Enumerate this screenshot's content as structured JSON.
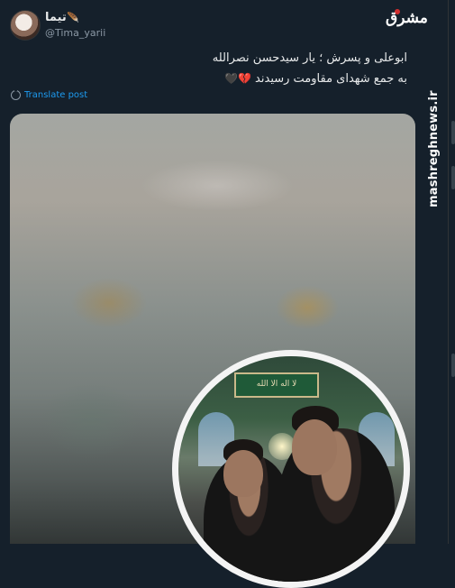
{
  "tweet": {
    "display_name": "تیما",
    "handle": "@Tima_yarii",
    "text_line1": "ابوعلی و پسرش ؛ یار سیدحسن نصرالله",
    "text_line2": "به جمع شهدای مقاومت رسیدند",
    "emoji": "💔🖤",
    "translate_label": "Translate post"
  },
  "branding": {
    "logo_text": "مشرق",
    "watermark": "mashreghnews.ir"
  },
  "media": {
    "inset_banner_text": "لا اله الا الله"
  },
  "icons": {
    "feather": "feather-icon",
    "translate": "globe-icon"
  },
  "colors": {
    "background": "#15202b",
    "link": "#1d9bf0",
    "secondary_text": "#8b98a5"
  }
}
